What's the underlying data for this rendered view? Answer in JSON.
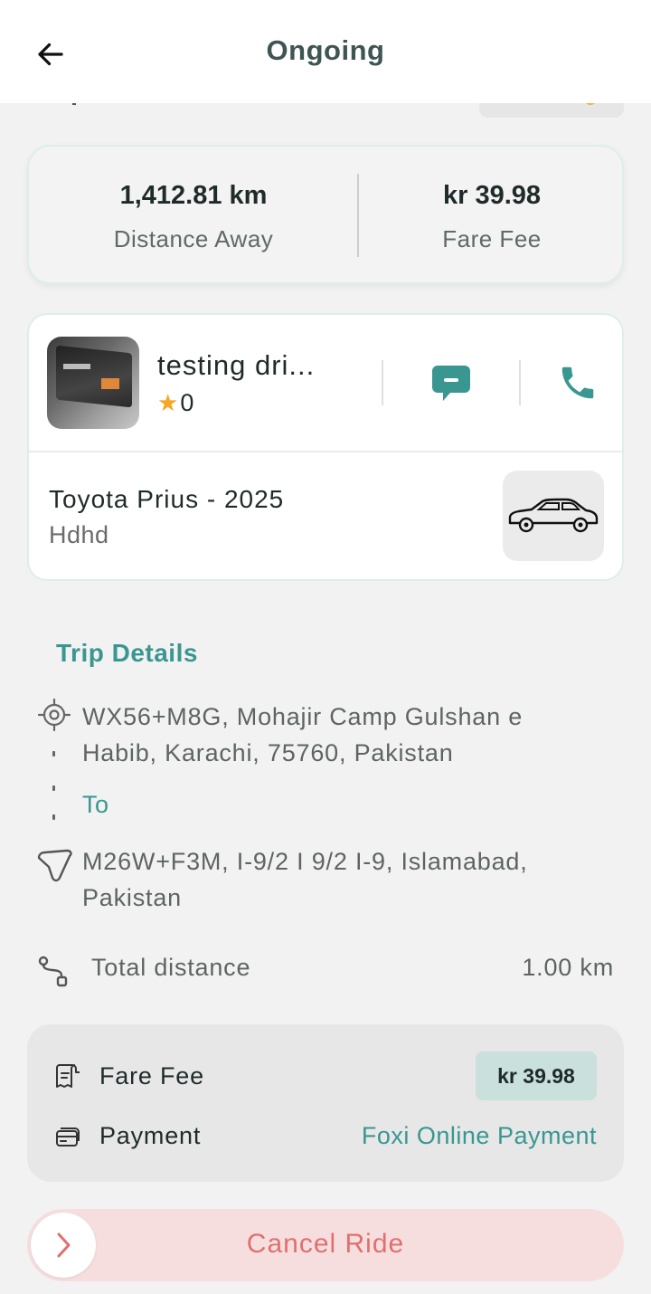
{
  "header": {
    "title": "Ongoing"
  },
  "stats": {
    "distance_value": "1,412.81 km",
    "distance_label": "Distance Away",
    "fare_value": "kr 39.98",
    "fare_label": "Fare Fee"
  },
  "driver": {
    "name": "testing dri...",
    "rating": "0",
    "car_model": "Toyota Prius - 2025",
    "car_plate": "Hdhd"
  },
  "trip": {
    "section_title": "Trip Details",
    "from_address": "WX56+M8G, Mohajir Camp Gulshan e Habib, Karachi, 75760, Pakistan",
    "to_label": "To",
    "to_address": "M26W+F3M, I-9/2 I 9/2 I-9, Islamabad, Pakistan",
    "total_distance_label": "Total distance",
    "total_distance_value": "1.00 km"
  },
  "fare": {
    "fare_label": "Fare Fee",
    "fare_value": "kr 39.98",
    "payment_label": "Payment",
    "payment_method": "Foxi Online Payment"
  },
  "actions": {
    "cancel_label": "Cancel Ride"
  },
  "colors": {
    "accent": "#3a9690",
    "cancel": "#e07070",
    "star": "#f5a623"
  },
  "icons": {
    "back": "arrow-left-icon",
    "chat": "chat-icon",
    "call": "phone-icon",
    "car": "car-icon",
    "pickup": "location-target-icon",
    "dropoff": "pin-icon",
    "route": "route-icon",
    "receipt": "receipt-icon",
    "card": "card-icon",
    "chevron": "chevron-right-icon"
  }
}
